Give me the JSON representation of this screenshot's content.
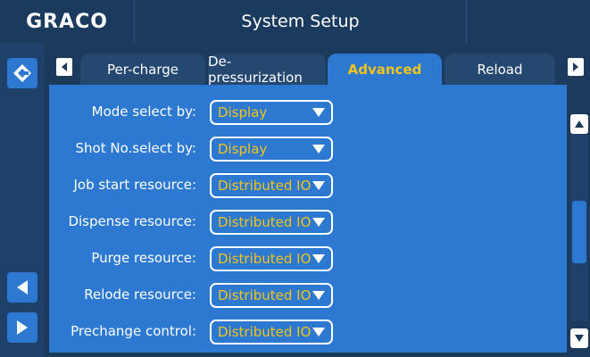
{
  "header": {
    "logo": "GRACO",
    "title": "System Setup"
  },
  "tabs": [
    {
      "label": "Per-charge",
      "active": false
    },
    {
      "label": "De-pressurization",
      "active": false
    },
    {
      "label": "Advanced",
      "active": true
    },
    {
      "label": "Reload",
      "active": false
    }
  ],
  "settings": [
    {
      "label": "Mode select by:",
      "value": "Display"
    },
    {
      "label": "Shot No.select by:",
      "value": "Display"
    },
    {
      "label": "Job start resource:",
      "value": "Distributed IO"
    },
    {
      "label": "Dispense resource:",
      "value": "Distributed IO"
    },
    {
      "label": "Purge resource:",
      "value": "Distributed IO"
    },
    {
      "label": "Relode resource:",
      "value": "Distributed IO"
    },
    {
      "label": "Prechange control:",
      "value": "Distributed IO"
    }
  ],
  "icons": {
    "home": "graco-home-icon",
    "back": "arrow-left-icon",
    "forward": "arrow-right-icon",
    "tab_prev": "tab-prev-icon",
    "tab_next": "tab-next-icon",
    "scroll_up": "scroll-up-icon",
    "scroll_down": "scroll-down-icon",
    "dropdown": "dropdown-caret-icon"
  },
  "colors": {
    "accent": "#2d78d0",
    "highlight": "#f3c41a",
    "background": "#1b3a5c"
  }
}
